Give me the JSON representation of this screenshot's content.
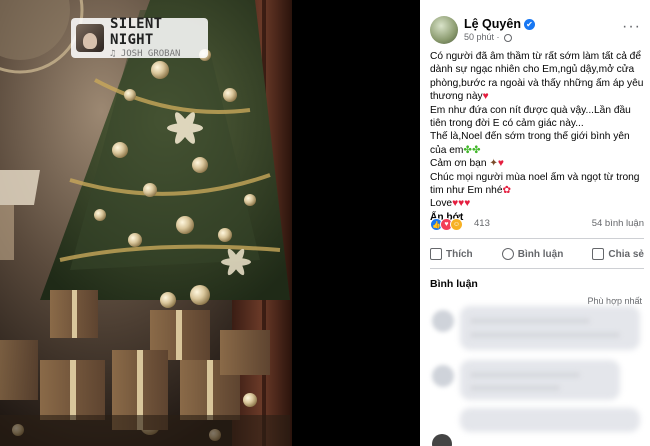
{
  "music": {
    "song": "SILENT NIGHT",
    "artist": "♫ JOSH GROBAN"
  },
  "post": {
    "author": "Lệ Quyên",
    "time": "50 phút",
    "text_lines": [
      "Có người đã âm thầm từ rất sớm làm tất cả để dành sự ngạc nhiên cho Em,ngủ dậy,mở cửa phòng,bước ra ngoài và thấy ",
      "những ấm áp yêu thương này",
      "Em như đứa con nít được quà vậy...Lần đầu tiên trong đời E có cảm giác này...",
      "Thế là,Noel đến sớm trong thế giới bình yên của em",
      "Cảm ơn bạn",
      "Chúc mọi người mùa noel ấm và ngọt từ trong tim như Em nhé",
      "Love"
    ],
    "see_less": "Ẩn bớt",
    "reaction_count": "413",
    "comment_count": "54 bình luận"
  },
  "actions": {
    "like": "Thích",
    "comment": "Bình luận",
    "share": "Chia sẻ"
  },
  "comments": {
    "title": "Bình luận",
    "sort_label": "Phù hợp nhất"
  },
  "icons": {
    "verified": "✔",
    "more": "···",
    "heart": "♥",
    "clover": "✤✤",
    "rose": "✿",
    "turkey": "✦",
    "like": "👍",
    "love": "♥",
    "haha": "☺"
  },
  "colors": {
    "brand": "#1877f2",
    "heart": "#e41e3f",
    "text": "#050505",
    "muted": "#65676b"
  }
}
